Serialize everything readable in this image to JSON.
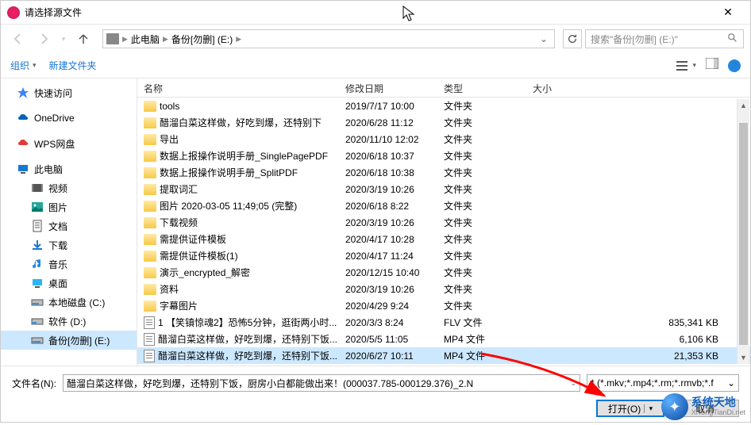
{
  "window": {
    "title": "请选择源文件"
  },
  "breadcrumb": {
    "seg1": "此电脑",
    "seg2": "备份[勿删] (E:)"
  },
  "search": {
    "placeholder": "搜索\"备份[勿删] (E:)\""
  },
  "toolbar": {
    "organize": "组织",
    "newfolder": "新建文件夹"
  },
  "sidebar": {
    "quick": "快速访问",
    "onedrive": "OneDrive",
    "wps": "WPS网盘",
    "thispc": "此电脑",
    "video": "视频",
    "pictures": "图片",
    "documents": "文档",
    "downloads": "下载",
    "music": "音乐",
    "desktop": "桌面",
    "diskc": "本地磁盘 (C:)",
    "diskd": "软件 (D:)",
    "diske": "备份[勿删] (E:)"
  },
  "columns": {
    "name": "名称",
    "date": "修改日期",
    "type": "类型",
    "size": "大小"
  },
  "rows": [
    {
      "icon": "folder",
      "name": "tools",
      "date": "2019/7/17  10:00",
      "type": "文件夹",
      "size": ""
    },
    {
      "icon": "folder",
      "name": "醋溜白菜这样做，好吃到爆，还特别下",
      "date": "2020/6/28 11:12",
      "type": "文件夹",
      "size": ""
    },
    {
      "icon": "folder",
      "name": "导出",
      "date": "2020/11/10 12:02",
      "type": "文件夹",
      "size": ""
    },
    {
      "icon": "folder",
      "name": "数据上报操作说明手册_SinglePagePDF",
      "date": "2020/6/18 10:37",
      "type": "文件夹",
      "size": ""
    },
    {
      "icon": "folder",
      "name": "数据上报操作说明手册_SplitPDF",
      "date": "2020/6/18 10:38",
      "type": "文件夹",
      "size": ""
    },
    {
      "icon": "folder",
      "name": "提取词汇",
      "date": "2020/3/19 10:26",
      "type": "文件夹",
      "size": ""
    },
    {
      "icon": "folder",
      "name": "图片 2020-03-05 11;49;05 (完整)",
      "date": "2020/6/18 8:22",
      "type": "文件夹",
      "size": ""
    },
    {
      "icon": "folder",
      "name": "下载视频",
      "date": "2020/3/19 10:26",
      "type": "文件夹",
      "size": ""
    },
    {
      "icon": "folder",
      "name": "需提供证件模板",
      "date": "2020/4/17 10:28",
      "type": "文件夹",
      "size": ""
    },
    {
      "icon": "folder",
      "name": "需提供证件模板(1)",
      "date": "2020/4/17 11:24",
      "type": "文件夹",
      "size": ""
    },
    {
      "icon": "folder",
      "name": "演示_encrypted_解密",
      "date": "2020/12/15 10:40",
      "type": "文件夹",
      "size": ""
    },
    {
      "icon": "folder",
      "name": "资料",
      "date": "2020/3/19 10:26",
      "type": "文件夹",
      "size": ""
    },
    {
      "icon": "folder",
      "name": "字幕图片",
      "date": "2020/4/29 9:24",
      "type": "文件夹",
      "size": ""
    },
    {
      "icon": "file",
      "name": "1 【笑镇惊魂2】恐怖5分钟，逛街两小时...",
      "date": "2020/3/3 8:24",
      "type": "FLV 文件",
      "size": "835,341 KB"
    },
    {
      "icon": "file",
      "name": "醋溜白菜这样做，好吃到爆，还特别下饭...",
      "date": "2020/5/5 11:05",
      "type": "MP4 文件",
      "size": "6,106 KB"
    },
    {
      "icon": "file",
      "name": "醋溜白菜这样做，好吃到爆，还特别下饭...",
      "date": "2020/6/27 10:11",
      "type": "MP4 文件",
      "size": "21,353 KB",
      "selected": true
    }
  ],
  "footer": {
    "fn_label": "文件名(N):",
    "fn_value": "醋溜白菜这样做，好吃到爆，还特别下饭，厨房小白都能做出来！(000037.785-000129.376)_2.N",
    "filter": "* (*.mkv;*.mp4;*.rm;*.rmvb;*.f",
    "open": "打开(O)",
    "cancel": "取消"
  },
  "watermark": {
    "cn": "系统天地",
    "en": "XiTongTianDi.net"
  }
}
